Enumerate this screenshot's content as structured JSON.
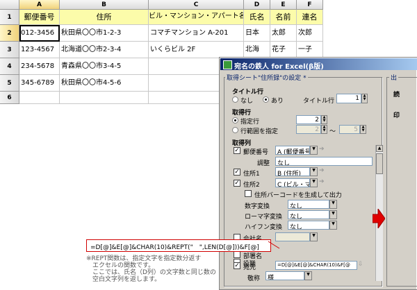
{
  "sheet": {
    "col_headers": [
      "A",
      "B",
      "C",
      "D",
      "E",
      "F"
    ],
    "row_numbers": [
      "1",
      "2",
      "3",
      "4",
      "5",
      "6"
    ],
    "header_row": [
      "郵便番号",
      "住所",
      "ビル・マンション・アパート名",
      "氏名",
      "名前",
      "連名"
    ],
    "rows": [
      [
        "012-3456",
        "秋田県〇〇市1-2-3",
        "コマチマンション A-201",
        "日本",
        "太郎",
        "次郎"
      ],
      [
        "123-4567",
        "北海道〇〇市2-3-4",
        "いくらビル 2F",
        "北海",
        "花子",
        "一子"
      ],
      [
        "234-5678",
        "青森県〇〇市3-4-5",
        "",
        "",
        "",
        ""
      ],
      [
        "345-6789",
        "秋田県〇〇市4-5-6",
        "",
        "",
        "",
        ""
      ],
      [
        "",
        "",
        "",
        "",
        "",
        ""
      ]
    ]
  },
  "dialog": {
    "title": "宛名の鉄人 for Excel(β版)",
    "section_title": "取得シート\"住所録\"の設定 *",
    "right_tab_label": "出",
    "right_text_1": "読",
    "right_text_2": "印",
    "title_row": {
      "label": "タイトル行",
      "opt_none": "なし",
      "opt_yes": "あり",
      "field_label": "タイトル行",
      "value": "1"
    },
    "fetch_row": {
      "label": "取得行",
      "opt_specified": "指定行",
      "specified_value": "2",
      "opt_range": "行範囲を指定",
      "range_from": "2",
      "range_sep": "～",
      "range_to": "5"
    },
    "fetch_cols": {
      "label": "取得列",
      "postal": {
        "label": "郵便番号",
        "value": "A (郵便番号)"
      },
      "adjust": {
        "label": "調整",
        "value": "なし"
      },
      "addr1": {
        "label": "住所1",
        "value": "B (住所)"
      },
      "addr2": {
        "label": "住所2",
        "value": "C (ビル・マンシ"
      },
      "barcode_label": "住所バーコードを生成して出力",
      "numeric": {
        "label": "数字変換",
        "value": "なし"
      },
      "roman": {
        "label": "ローマ字変換",
        "value": "なし"
      },
      "hyphen": {
        "label": "ハイフン変換",
        "value": "なし"
      },
      "company": {
        "label": "会社名"
      },
      "dept": {
        "label": "部署名"
      },
      "title": {
        "label": "役職"
      },
      "addressee": {
        "label": "宛先",
        "value": "=D[@]&E[@]&CHAR(10)&F[@"
      },
      "honorific": {
        "label": "敬称",
        "value": "様"
      }
    }
  },
  "formula_callout": "=D[@]&E[@]&CHAR(10)&REPT(\"　\",LEN(D[@]))&F[@]",
  "notes": [
    "※REPT関数は、指定文字を指定数分返す",
    "　エクセルの関数です。",
    "　ここでは、氏名（D列）の文字数と同じ数の",
    "　空白文字列を返します。"
  ],
  "colors": {
    "header_fill": "#fcfcaa",
    "title_bar": "#0a246a",
    "callout_border": "#d00000",
    "arrow": "#e00000"
  }
}
